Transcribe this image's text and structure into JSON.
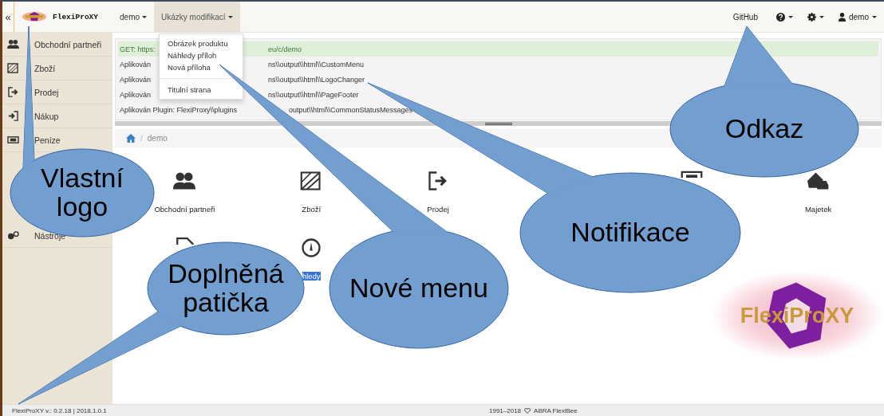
{
  "navbar": {
    "collapse": "«",
    "brand": "FlexiProXY",
    "menus": [
      {
        "label": "demo",
        "expanded": false
      },
      {
        "label": "Ukázky modifikací",
        "expanded": true
      }
    ],
    "link": "GitHub",
    "user": "demo"
  },
  "dropdown": {
    "items": [
      {
        "label": "Obrázek produktu",
        "kind": "item"
      },
      {
        "label": "Náhledy příloh",
        "kind": "item"
      },
      {
        "label": "Nová příloha",
        "kind": "item"
      },
      {
        "kind": "divider"
      },
      {
        "label": "Titulní strana",
        "kind": "item"
      }
    ]
  },
  "sidebar": {
    "items": [
      {
        "label": "Obchodní partneři"
      },
      {
        "label": "Zboží"
      },
      {
        "label": "Prodej"
      },
      {
        "label": "Nákup"
      },
      {
        "label": "Peníze"
      },
      {
        "label": "Nástroje"
      }
    ]
  },
  "notifications": [
    {
      "kind": "success",
      "start": "GET: https:",
      "end": "eu/c/demo"
    },
    {
      "kind": "info",
      "start": "Aplikován",
      "end": "ns\\\\output\\\\html\\\\CustomMenu"
    },
    {
      "kind": "info",
      "start": "Aplikován",
      "end": "ns\\\\output\\\\html\\\\LogoChanger"
    },
    {
      "kind": "info",
      "start": "Aplikován",
      "end": "ns\\\\output\\\\html\\\\PageFooter"
    },
    {
      "kind": "info",
      "start": "Aplikován Plugin: FlexiProxy\\\\plugins",
      "end": "output\\\\html\\\\CommonStatusMessages"
    }
  ],
  "breadcrumb": {
    "separator": "/",
    "current": "demo"
  },
  "tiles": [
    {
      "kind": "module",
      "label": "Obchodní partneři",
      "highlighted": false
    },
    {
      "kind": "module",
      "label": "Zboží",
      "highlighted": false
    },
    {
      "kind": "module",
      "label": "Prodej",
      "highlighted": false
    },
    {
      "kind": "icon"
    },
    {
      "kind": "module",
      "label": "Majetek",
      "highlighted": false
    },
    {
      "kind": "icon"
    },
    {
      "kind": "module",
      "label": "hledy",
      "highlighted": true
    }
  ],
  "logo": "FlexiProXY",
  "footer": {
    "version": "FlexiProXY v.: 0.2.18 | 2018.1.0.1",
    "copyright": "1991–2018",
    "vendor": "ABRA FlexiBee"
  },
  "callouts": [
    {
      "text": "Vlastní logo"
    },
    {
      "text": "Doplněná patička"
    },
    {
      "text": "Nové menu"
    },
    {
      "text": "Notifikace"
    },
    {
      "text": "Odkaz"
    }
  ]
}
